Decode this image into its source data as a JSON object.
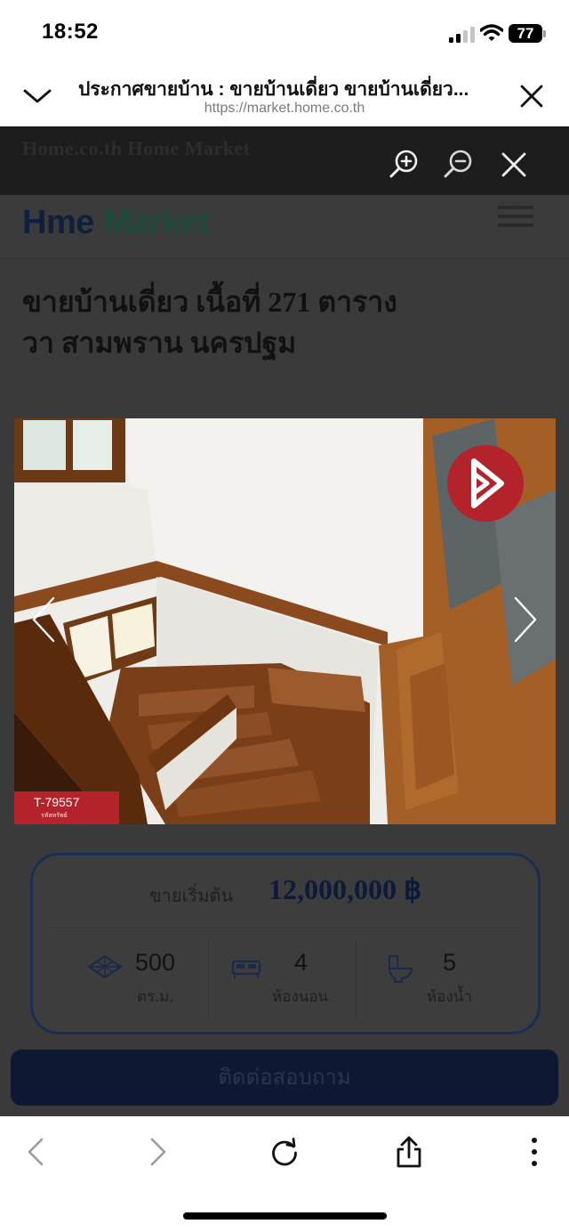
{
  "status_bar": {
    "time": "18:52",
    "battery": "77",
    "icons": [
      "signal-icon",
      "wifi-icon",
      "battery-icon"
    ]
  },
  "browser": {
    "title": "ประกาศขายบ้าน : ขายบ้านเดี่ยว ขายบ้านเดี่ยว...",
    "url": "https://market.home.co.th",
    "icons": [
      "chevron-down-icon",
      "close-icon"
    ]
  },
  "viewer": {
    "icons": [
      "zoom-in-icon",
      "zoom-out-icon",
      "close-icon",
      "chevron-left-icon",
      "chevron-right-icon"
    ]
  },
  "page": {
    "strip_text": "Home.co.th   Home Market",
    "logo": {
      "part1": "H",
      "part2": "me ",
      "part3": "Market"
    },
    "title_line1": "ขายบ้านเดี่ยว เนื้อที่ 271 ตาราง",
    "title_line2": "วา สามพราน นครปฐม",
    "photo_code": "T-79557",
    "photo_code_sub": "รหัสทรัพย์",
    "price_label": "ขายเริ่มต้น",
    "price_value": "12,000,000 ฿",
    "stats": [
      {
        "icon": "area-icon",
        "value": "500",
        "unit": "ตร.ม."
      },
      {
        "icon": "bed-icon",
        "value": "4",
        "unit": "ห้องนอน"
      },
      {
        "icon": "toilet-icon",
        "value": "5",
        "unit": "ห้องน้ำ"
      }
    ],
    "contact_button": "ติดต่อสอบถาม"
  },
  "toolbar": {
    "icons": [
      "back-icon",
      "forward-icon",
      "reload-icon",
      "share-icon",
      "more-icon"
    ]
  },
  "colors": {
    "brand_red": "#b4222b",
    "brand_navy": "#0e1833",
    "wood": "#8b4a1e"
  }
}
